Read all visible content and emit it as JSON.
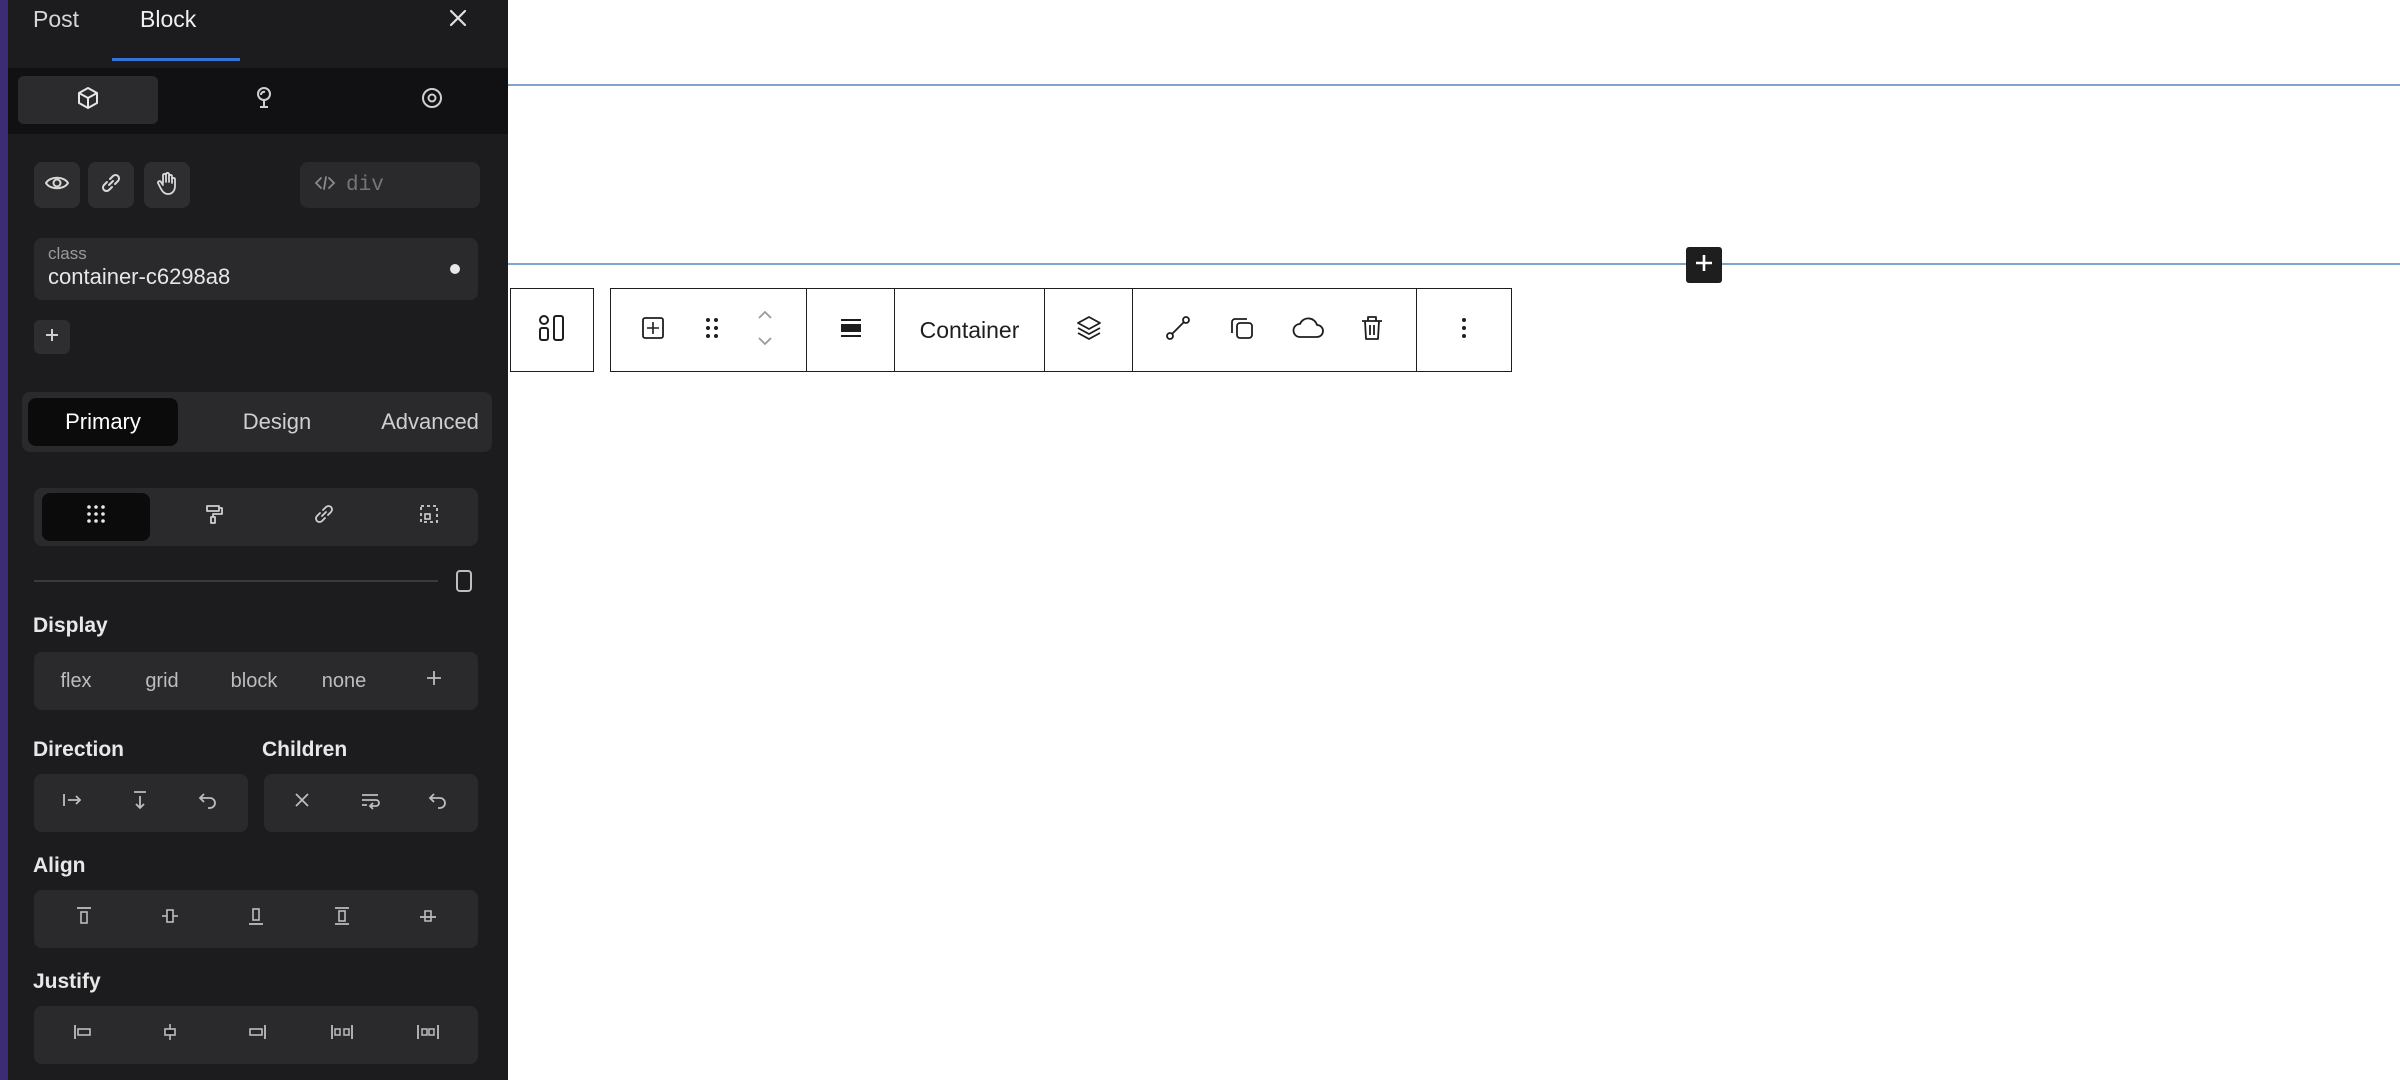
{
  "sidebar": {
    "tabs": [
      {
        "label": "Post",
        "active": false
      },
      {
        "label": "Block",
        "active": true
      }
    ],
    "modes": [
      "cube-icon",
      "brush-icon",
      "target-icon"
    ],
    "actions": [
      "eye-icon",
      "link-icon",
      "hand-icon"
    ],
    "tag": {
      "placeholder": "div"
    },
    "class": {
      "label": "class",
      "value": "container-c6298a8"
    },
    "panel_tabs": [
      {
        "label": "Primary",
        "active": true
      },
      {
        "label": "Design",
        "active": false
      },
      {
        "label": "Advanced",
        "active": false
      }
    ],
    "layout_tabs": [
      "grid-dots-icon",
      "paint-roller-icon",
      "link-chain-icon",
      "dashed-box-icon"
    ],
    "display": {
      "label": "Display",
      "options": [
        "flex",
        "grid",
        "block",
        "none"
      ]
    },
    "direction": {
      "label": "Direction"
    },
    "children": {
      "label": "Children"
    },
    "align": {
      "label": "Align"
    },
    "justify": {
      "label": "Justify"
    }
  },
  "toolbar": {
    "block_label": "Container"
  },
  "colors": {
    "sidebar_bg": "#1c1c1e",
    "selection": "#7fa6c9",
    "accent": "#3574d4"
  }
}
